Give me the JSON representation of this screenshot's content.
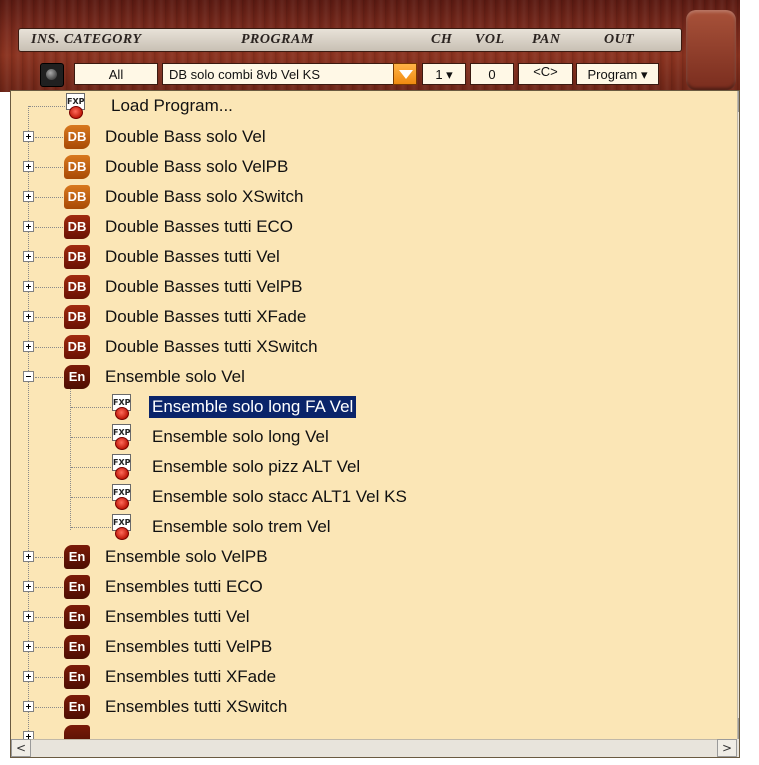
{
  "header": {
    "columns": {
      "ins_category": "INS. CATEGORY",
      "program": "PROGRAM",
      "ch": "CH",
      "vol": "VOL",
      "pan": "PAN",
      "out": "OUT"
    },
    "category_value": "All",
    "program_value": "DB solo combi 8vb Vel KS",
    "channel_value": "1 ▾",
    "volume_value": "0",
    "pan_value": "<C>",
    "out_value": "Program ▾"
  },
  "tree": {
    "load_program": "Load Program...",
    "items": [
      {
        "label": "Double Bass solo Vel",
        "badge": "DB"
      },
      {
        "label": "Double Bass solo VelPB",
        "badge": "DB"
      },
      {
        "label": "Double Bass solo XSwitch",
        "badge": "DB"
      },
      {
        "label": "Double Basses tutti ECO",
        "badge": "DB"
      },
      {
        "label": "Double Basses tutti Vel",
        "badge": "DB"
      },
      {
        "label": "Double Basses tutti VelPB",
        "badge": "DB"
      },
      {
        "label": "Double Basses tutti XFade",
        "badge": "DB"
      },
      {
        "label": "Double Basses tutti XSwitch",
        "badge": "DB"
      },
      {
        "label": "Ensemble solo Vel",
        "badge": "En"
      },
      {
        "label": "Ensemble solo long FA Vel",
        "badge": "FXP"
      },
      {
        "label": "Ensemble solo long Vel",
        "badge": "FXP"
      },
      {
        "label": "Ensemble solo pizz ALT Vel",
        "badge": "FXP"
      },
      {
        "label": "Ensemble solo stacc ALT1 Vel KS",
        "badge": "FXP"
      },
      {
        "label": "Ensemble solo trem Vel",
        "badge": "FXP"
      },
      {
        "label": "Ensemble solo VelPB",
        "badge": "En"
      },
      {
        "label": "Ensembles tutti ECO",
        "badge": "En"
      },
      {
        "label": "Ensembles tutti Vel",
        "badge": "En"
      },
      {
        "label": "Ensembles tutti VelPB",
        "badge": "En"
      },
      {
        "label": "Ensembles tutti XFade",
        "badge": "En"
      },
      {
        "label": "Ensembles tutti XSwitch",
        "badge": "En"
      }
    ],
    "selected_label": "Ensemble solo long FA Vel"
  },
  "scrollbar": {
    "up_icon": "∧",
    "down_icon": "∨",
    "left_icon": "<",
    "right_icon": ">"
  },
  "colors": {
    "list_background": "#fbe6b6",
    "selection": "#0a246a",
    "dropdown_accent": "#f08a10"
  }
}
